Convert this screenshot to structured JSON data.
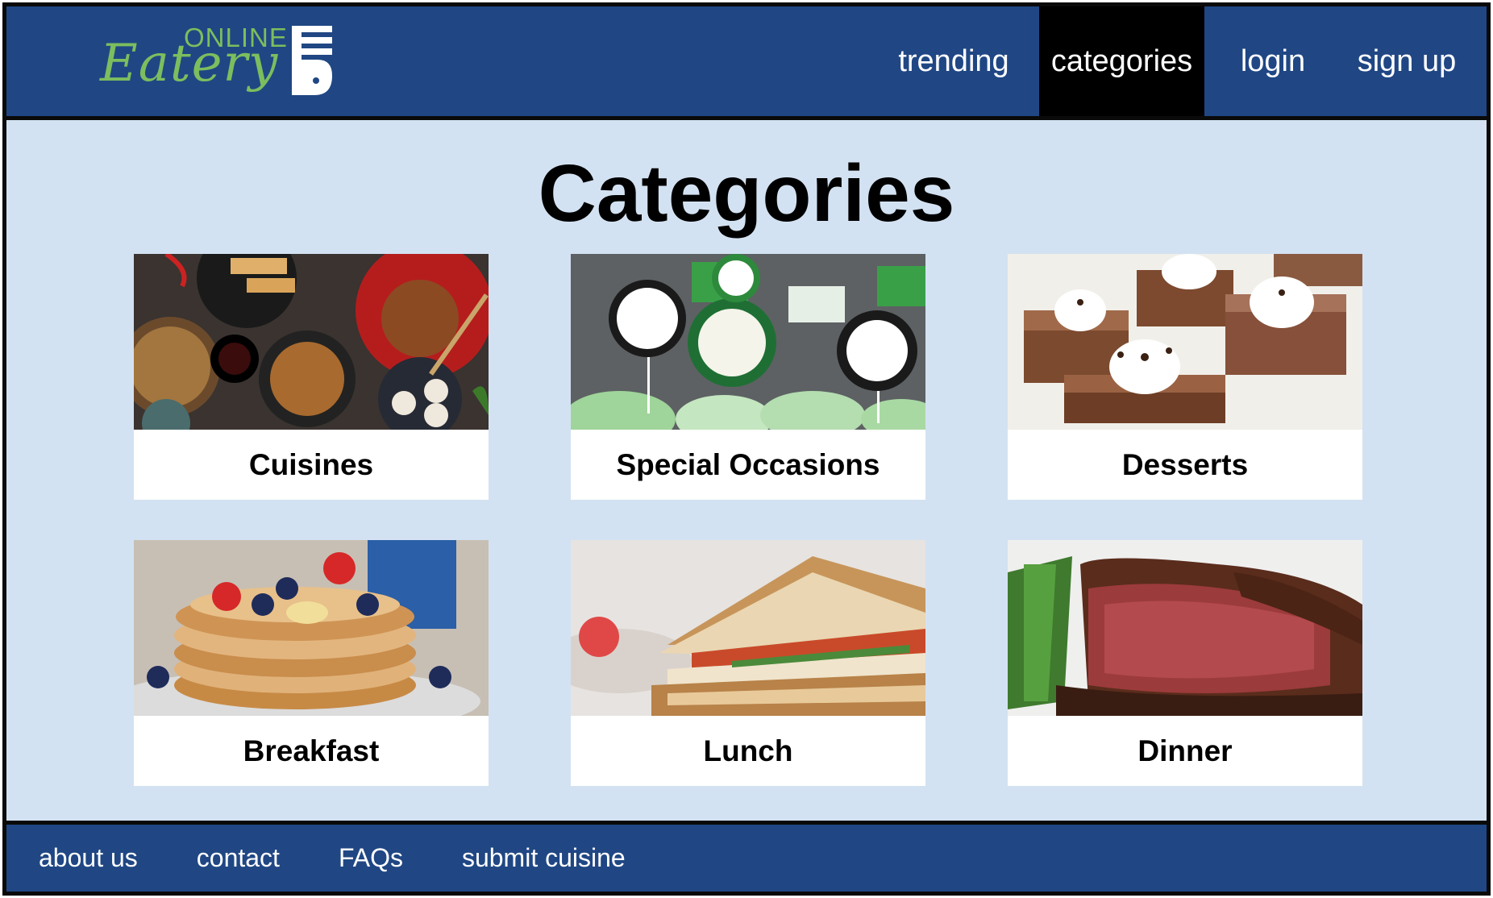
{
  "header": {
    "logo": {
      "top_text": "ONLINE",
      "script_text": "Eatery"
    },
    "nav": [
      {
        "label": "trending",
        "active": false
      },
      {
        "label": "categories",
        "active": true
      },
      {
        "label": "login",
        "active": false
      },
      {
        "label": "sign up",
        "active": false
      }
    ]
  },
  "main": {
    "title": "Categories",
    "categories": [
      {
        "label": "Cuisines",
        "image": "asian-food-spread"
      },
      {
        "label": "Special Occasions",
        "image": "st-patricks-cupcakes"
      },
      {
        "label": "Desserts",
        "image": "brownies-with-cream"
      },
      {
        "label": "Breakfast",
        "image": "pancakes-with-berries"
      },
      {
        "label": "Lunch",
        "image": "grilled-sandwich"
      },
      {
        "label": "Dinner",
        "image": "steak-with-green-beans"
      }
    ]
  },
  "footer": {
    "links": [
      "about us",
      "contact",
      "FAQs",
      "submit cuisine"
    ]
  },
  "colors": {
    "header_bg": "#204784",
    "page_bg": "#d3e2f2",
    "active_nav_bg": "#000000",
    "logo_green": "#7cbe5e"
  }
}
